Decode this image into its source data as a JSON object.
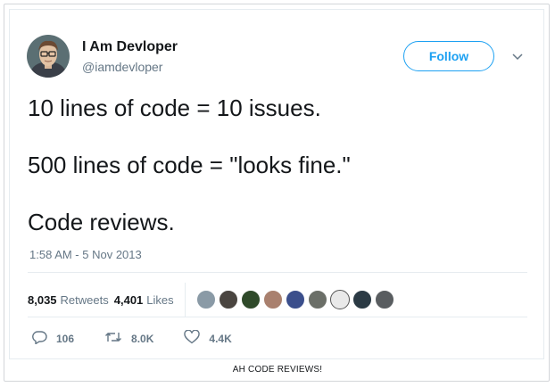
{
  "tweet": {
    "author_name": "I Am Devloper",
    "author_handle": "@iamdevloper",
    "follow_label": "Follow",
    "lines": [
      "10 lines of code = 10 issues.",
      "500 lines of code = \"looks fine.\"",
      "Code reviews."
    ],
    "timestamp": "1:58 AM - 5 Nov 2013"
  },
  "stats": {
    "retweets_count": "8,035",
    "retweets_label": "Retweets",
    "likes_count": "4,401",
    "likes_label": "Likes"
  },
  "likers": [
    "#8a9aa6",
    "#4a4540",
    "#2f4a2a",
    "#a9806e",
    "#3b4f8c",
    "#6b6f68",
    "#e9e9e9",
    "#2b3a44",
    "#595d60"
  ],
  "actions": {
    "reply_count": "106",
    "retweet_count": "8.0K",
    "like_count": "4.4K"
  },
  "caption": "AH CODE REVIEWS!",
  "colors": {
    "accent": "#1da1f2",
    "muted": "#657786",
    "text": "#14171a"
  }
}
